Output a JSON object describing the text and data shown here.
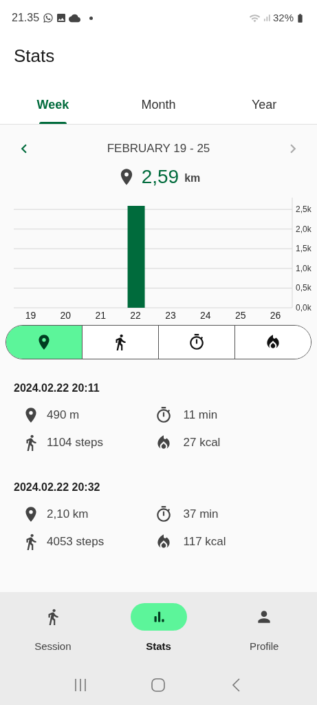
{
  "status_bar": {
    "time": "21.35",
    "battery": "32%"
  },
  "header": {
    "title": "Stats"
  },
  "tabs": [
    {
      "label": "Week",
      "selected": true
    },
    {
      "label": "Month",
      "selected": false
    },
    {
      "label": "Year",
      "selected": false
    }
  ],
  "period": {
    "label": "FEBRUARY 19 - 25",
    "prev_enabled": true,
    "next_enabled": false
  },
  "total": {
    "value": "2,59",
    "unit": "km"
  },
  "chart_data": {
    "type": "bar",
    "categories": [
      "19",
      "20",
      "21",
      "22",
      "23",
      "24",
      "25",
      "26"
    ],
    "grid": true,
    "series": [
      {
        "color": "#006b3c",
        "values": [
          0,
          0,
          0,
          2590,
          0,
          0,
          0,
          0
        ]
      }
    ],
    "ylim": [
      0,
      2800
    ],
    "yticks": [
      {
        "value": 0,
        "label": "0,0k"
      },
      {
        "value": 500,
        "label": "0,5k"
      },
      {
        "value": 1000,
        "label": "1,0k"
      },
      {
        "value": 1500,
        "label": "1,5k"
      },
      {
        "value": 2000,
        "label": "2,0k"
      },
      {
        "value": 2500,
        "label": "2,5k"
      }
    ]
  },
  "metric_toggle": [
    {
      "kind": "distance",
      "selected": true
    },
    {
      "kind": "steps",
      "selected": false
    },
    {
      "kind": "duration",
      "selected": false
    },
    {
      "kind": "calories",
      "selected": false
    }
  ],
  "sessions": [
    {
      "title": "2024.02.22 20:11",
      "metrics": [
        {
          "kind": "distance",
          "value": "490 m"
        },
        {
          "kind": "duration",
          "value": "11 min"
        },
        {
          "kind": "steps",
          "value": "1104 steps"
        },
        {
          "kind": "calories",
          "value": "27 kcal"
        }
      ]
    },
    {
      "title": "2024.02.22 20:32",
      "metrics": [
        {
          "kind": "distance",
          "value": "2,10 km"
        },
        {
          "kind": "duration",
          "value": "37 min"
        },
        {
          "kind": "steps",
          "value": "4053 steps"
        },
        {
          "kind": "calories",
          "value": "117 kcal"
        }
      ]
    }
  ],
  "bottom_nav": [
    {
      "kind": "session",
      "label": "Session",
      "selected": false
    },
    {
      "kind": "stats",
      "label": "Stats",
      "selected": true
    },
    {
      "kind": "profile",
      "label": "Profile",
      "selected": false
    }
  ]
}
